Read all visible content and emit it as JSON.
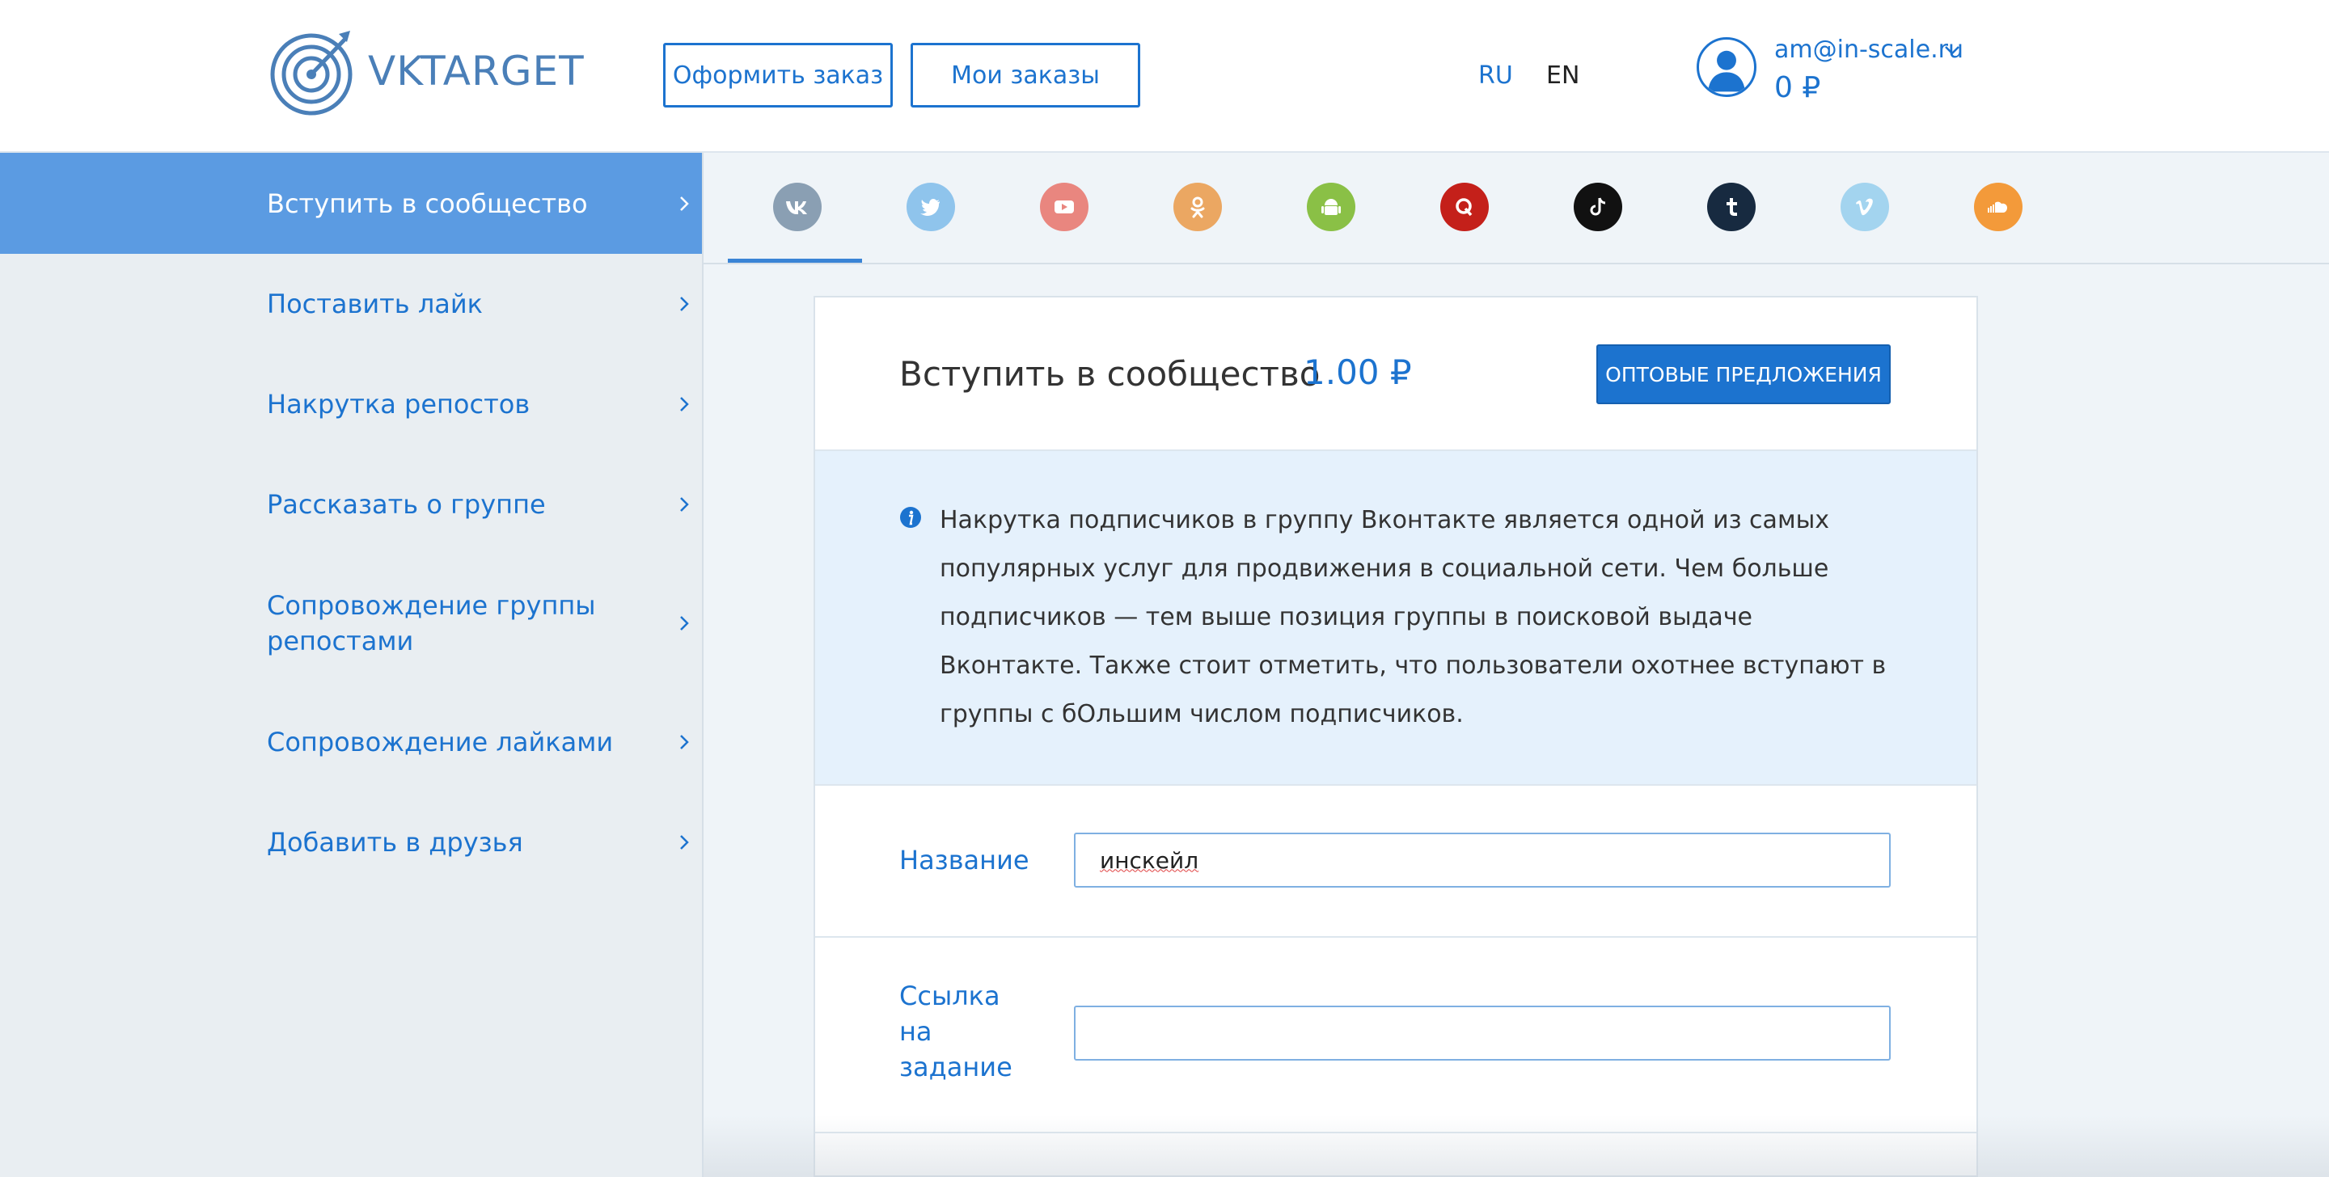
{
  "header": {
    "logo_text_vk": "VK",
    "logo_text_target": "TARGET",
    "order_button": "Оформить заказ",
    "my_orders_button": "Мои заказы",
    "languages": [
      "RU",
      "EN"
    ],
    "active_language": "RU",
    "user_email": "am@in-scale.ru",
    "balance": "0 ₽"
  },
  "sidebar": {
    "items": [
      {
        "label": "Вступить в сообщество",
        "active": true
      },
      {
        "label": "Поставить лайк",
        "active": false
      },
      {
        "label": "Накрутка репостов",
        "active": false
      },
      {
        "label": "Рассказать о группе",
        "active": false
      },
      {
        "label": "Сопровождение группы репостами",
        "active": false
      },
      {
        "label": "Сопровождение лайками",
        "active": false
      },
      {
        "label": "Добавить в друзья",
        "active": false
      }
    ]
  },
  "social_tabs": [
    {
      "icon": "vk-icon",
      "color": "#8a9fb3",
      "active": true
    },
    {
      "icon": "twitter-icon",
      "color": "#8fc4ec"
    },
    {
      "icon": "youtube-icon",
      "color": "#e9867f"
    },
    {
      "icon": "odnoklassniki-icon",
      "color": "#eba762"
    },
    {
      "icon": "android-icon",
      "color": "#8ac046"
    },
    {
      "icon": "quora-icon",
      "color": "#c4201a"
    },
    {
      "icon": "tiktok-icon",
      "color": "#111111"
    },
    {
      "icon": "tumblr-icon",
      "color": "#172a40"
    },
    {
      "icon": "vimeo-icon",
      "color": "#a3d4ef"
    },
    {
      "icon": "soundcloud-icon",
      "color": "#f39a3a"
    }
  ],
  "card": {
    "title": "Вступить в сообщество",
    "price": "1.00 ₽",
    "wholesale_button": "ОПТОВЫЕ ПРЕДЛОЖЕНИЯ",
    "info_text": "Накрутка подписчиков в группу Вконтакте является одной из самых популярных услуг для продвижения в социальной сети. Чем больше подписчиков — тем выше позиция группы в поисковой выдаче Вконтакте. Также стоит отметить, что пользователи охотнее вступают в группы с бОльшим числом подписчиков.",
    "fields": {
      "name_label": "Название",
      "name_value": "инскейл",
      "link_label": "Ссылка на задание",
      "link_value": ""
    }
  },
  "colors": {
    "accent": "#1c73cf",
    "sidebar_active": "#5b9be2",
    "info_bg": "#e5f1fc"
  }
}
